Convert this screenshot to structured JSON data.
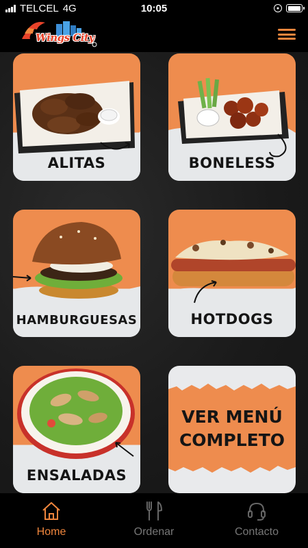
{
  "status_bar": {
    "carrier": "TELCEL",
    "network": "4G",
    "time": "10:05",
    "battery_level": 0.95
  },
  "header": {
    "logo_text": "Wings City",
    "menu_icon": "hamburger-menu-icon",
    "accent_color": "#f0863d"
  },
  "tiles": [
    {
      "label": "ALITAS"
    },
    {
      "label": "BONELESS"
    },
    {
      "label": "HAMBURGUESAS"
    },
    {
      "label": "HOTDOGS"
    },
    {
      "label": "ENSALADAS"
    },
    {
      "label_line1": "VER MENÚ",
      "label_line2": "COMPLETO"
    }
  ],
  "tab_bar": {
    "items": [
      {
        "label": "Home",
        "icon": "home-icon",
        "active": true
      },
      {
        "label": "Ordenar",
        "icon": "fork-knife-icon",
        "active": false
      },
      {
        "label": "Contacto",
        "icon": "headset-icon",
        "active": false
      }
    ]
  }
}
